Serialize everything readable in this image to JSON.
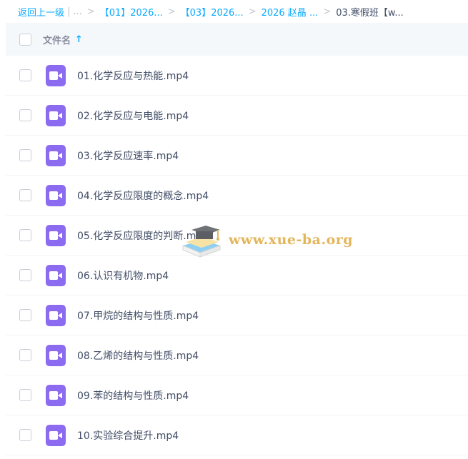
{
  "breadcrumb": {
    "back": "返回上一级",
    "sep_bar": "|",
    "ellipsis": "...",
    "sep": ">",
    "items": [
      "【01】2026...",
      "【03】2026...",
      "2026 赵晶 ..."
    ],
    "current": "03.寒假班【w..."
  },
  "header": {
    "column_label": "文件名",
    "sort_glyph": "↑"
  },
  "files": [
    "01.化学反应与热能.mp4",
    "02.化学反应与电能.mp4",
    "03.化学反应速率.mp4",
    "04.化学反应限度的概念.mp4",
    "05.化学反应限度的判断.mp4",
    "06.认识有机物.mp4",
    "07.甲烷的结构与性质.mp4",
    "08.乙烯的结构与性质.mp4",
    "09.苯的结构与性质.mp4",
    "10.实验综合提升.mp4"
  ],
  "watermark": {
    "text": "www.xue-ba.org"
  },
  "colors": {
    "accent": "#09aaff",
    "video_icon": "#8c6bf0",
    "header_bg": "#f5f8fb",
    "watermark_text": "#e3b65c"
  },
  "icons": {
    "file": "video-file-icon",
    "sort": "sort-ascending-icon",
    "watermark": "graduation-cap-book-icon"
  }
}
